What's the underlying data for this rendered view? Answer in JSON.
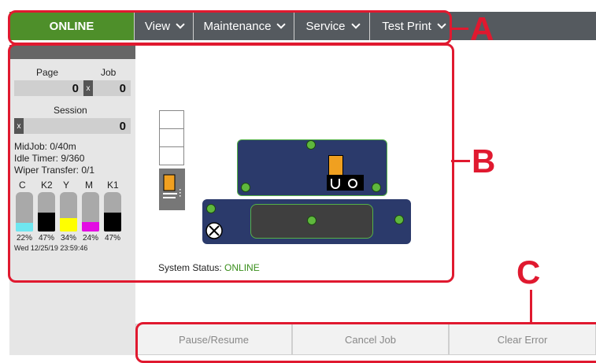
{
  "nav": {
    "status": "ONLINE",
    "menus": [
      "View",
      "Maintenance",
      "Service",
      "Test Print"
    ]
  },
  "sidebar": {
    "page_label": "Page",
    "job_label": "Job",
    "page_value": "0",
    "job_value": "0",
    "clear_mark": "x",
    "session_label": "Session",
    "session_value": "0",
    "midjob": "MidJob: 0/40m",
    "idle_timer": "Idle Timer: 9/360",
    "wiper_transfer": "Wiper Transfer: 0/1",
    "inks": [
      {
        "name": "C",
        "percent": "22%",
        "level": 0.22,
        "color": "#6fe6f0"
      },
      {
        "name": "K2",
        "percent": "47%",
        "level": 0.47,
        "color": "#000000"
      },
      {
        "name": "Y",
        "percent": "34%",
        "level": 0.34,
        "color": "#ffff00"
      },
      {
        "name": "M",
        "percent": "24%",
        "level": 0.24,
        "color": "#e30de3"
      },
      {
        "name": "K1",
        "percent": "47%",
        "level": 0.47,
        "color": "#000000"
      }
    ],
    "timestamp": "Wed 12/25/19 23:59:46"
  },
  "main": {
    "system_status_label": "System Status:",
    "system_status_value": "ONLINE",
    "status_color": "#3a8f1c"
  },
  "buttons": {
    "pause_resume": "Pause/Resume",
    "cancel_job": "Cancel Job",
    "clear_error": "Clear Error"
  },
  "callouts": {
    "a": "A",
    "b": "B",
    "c": "C"
  }
}
